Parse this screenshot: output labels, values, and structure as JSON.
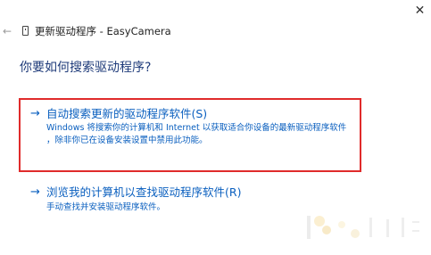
{
  "window": {
    "close_glyph": "✕",
    "back_glyph": "←",
    "title": "更新驱动程序 - EasyCamera"
  },
  "main": {
    "heading": "你要如何搜索驱动程序?"
  },
  "options": [
    {
      "arrow": "→",
      "title": "自动搜索更新的驱动程序软件(S)",
      "desc_line1": "Windows 将搜索你的计算机和 Internet 以获取适合你设备的最新驱动程序软件",
      "desc_line2": "，除非你已在设备安装设置中禁用此功能。"
    },
    {
      "arrow": "→",
      "title": "浏览我的计算机以查找驱动程序软件(R)",
      "desc_line1": "手动查找并安装驱动程序软件。"
    }
  ],
  "colors": {
    "link_blue": "#0a5fbf",
    "heading_blue": "#1f3b7a",
    "highlight_red": "#e02b2b"
  },
  "icons": {
    "close": "close-icon",
    "back": "back-arrow-icon",
    "device": "device-icon"
  }
}
